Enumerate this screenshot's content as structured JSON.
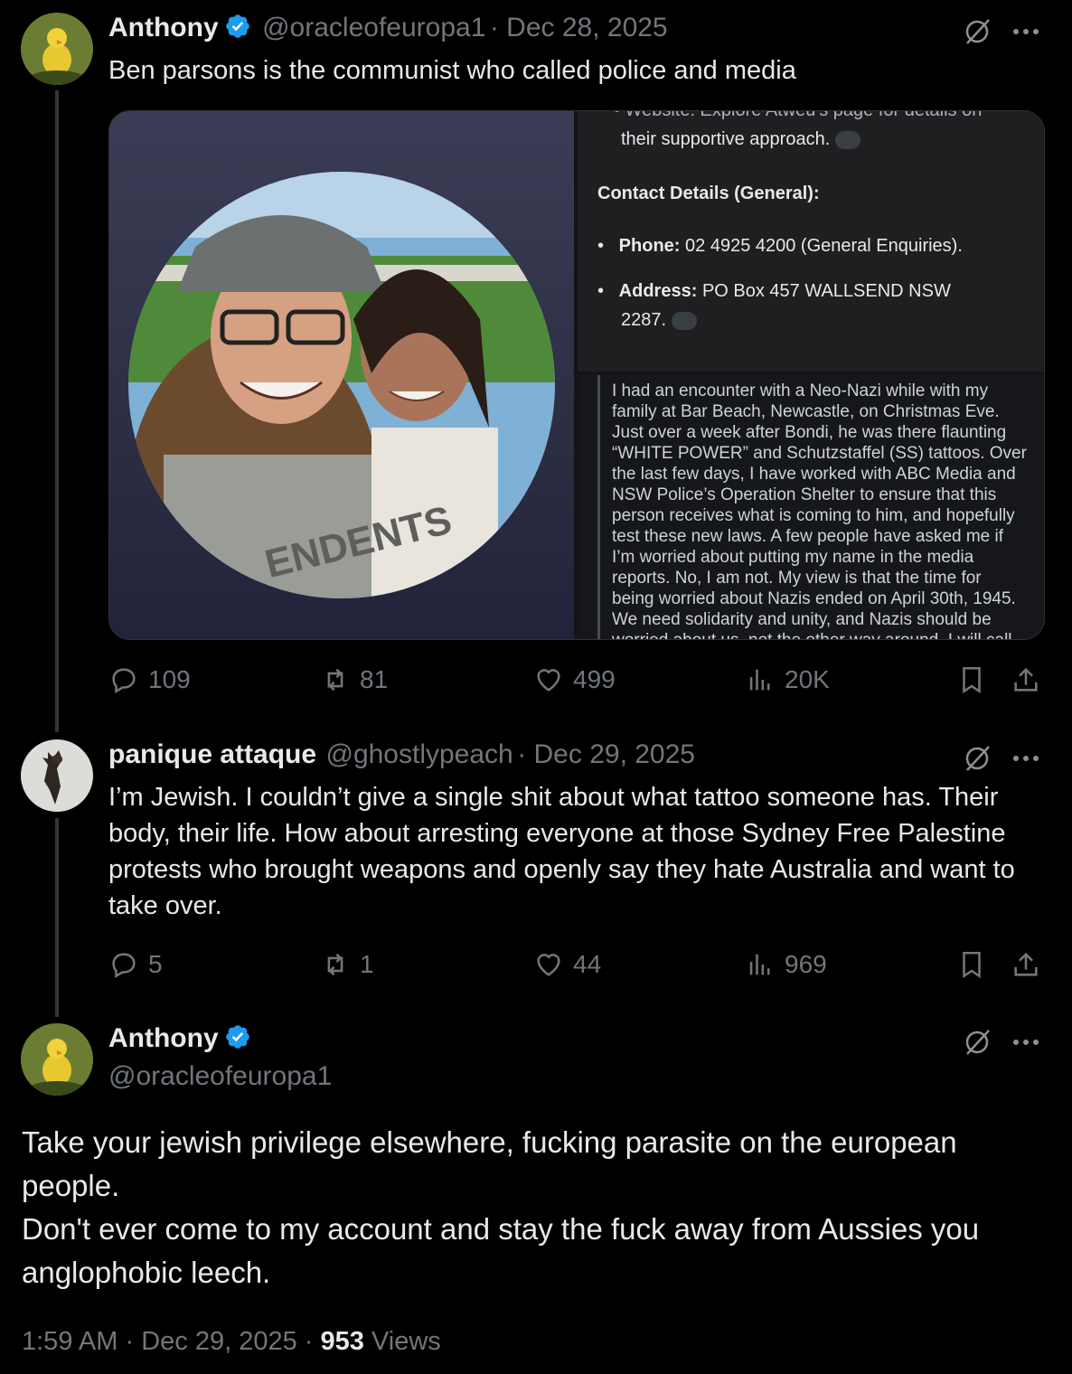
{
  "tweet1": {
    "name": "Anthony",
    "handle": "@oracleofeuropa1",
    "date": "Dec 28, 2025",
    "text": "Ben parsons is the communist who called police and media",
    "media": {
      "top_partial": "• Website: Explore Atweu's page for details on",
      "line1": "their supportive approach.",
      "contact_heading": "Contact Details (General):",
      "phone_label": "Phone:",
      "phone_value": "02 4925 4200 (General Enquiries).",
      "address_label": "Address:",
      "address_value": "PO Box 457 WALLSEND NSW",
      "address_line2": "2287.",
      "post_text": "I had an encounter with a Neo-Nazi while with my family at Bar Beach, Newcastle, on Christmas Eve. Just over a week after Bondi, he was there flaunting “WHITE POWER” and Schutzstaffel (SS) tattoos. Over the last few days, I have worked with ABC Media and NSW Police’s Operation Shelter to ensure that this person receives what is coming to him, and hopefully test these new laws. A few people have asked me if I’m worried about putting my name in the media reports. No, I am not. My view is that the time for being worried about Nazis ended on April 30th, 1945. We need solidarity and unity, and Nazis should be worried about us, not the other way around. I will call out racism and",
      "shirt_text": "ENDENTS"
    },
    "stats": {
      "replies": "109",
      "reposts": "81",
      "likes": "499",
      "views": "20K"
    }
  },
  "tweet2": {
    "name": "panique attaque",
    "handle": "@ghostlypeach",
    "date": "Dec 29, 2025",
    "text": "I’m Jewish. I couldn’t give a single shit about what tattoo someone has. Their body, their life. How about arresting everyone at those Sydney Free Palestine protests who brought weapons and openly say they hate Australia and want to take over.",
    "stats": {
      "replies": "5",
      "reposts": "1",
      "likes": "44",
      "views": "969"
    }
  },
  "tweet3": {
    "name": "Anthony",
    "handle": "@oracleofeuropa1",
    "text_line1": "Take your jewish privilege elsewhere, fucking parasite on the european people.",
    "text_line2": "Don't ever come to my account and stay the fuck away from Aussies you anglophobic leech.",
    "time": "1:59 AM",
    "date": "Dec 29, 2025",
    "views_count": "953",
    "views_label": "Views",
    "sep": "·"
  },
  "colors": {
    "background": "#000000",
    "text": "#e7e9ea",
    "muted": "#71767b",
    "verified": "#1d9bf0"
  }
}
